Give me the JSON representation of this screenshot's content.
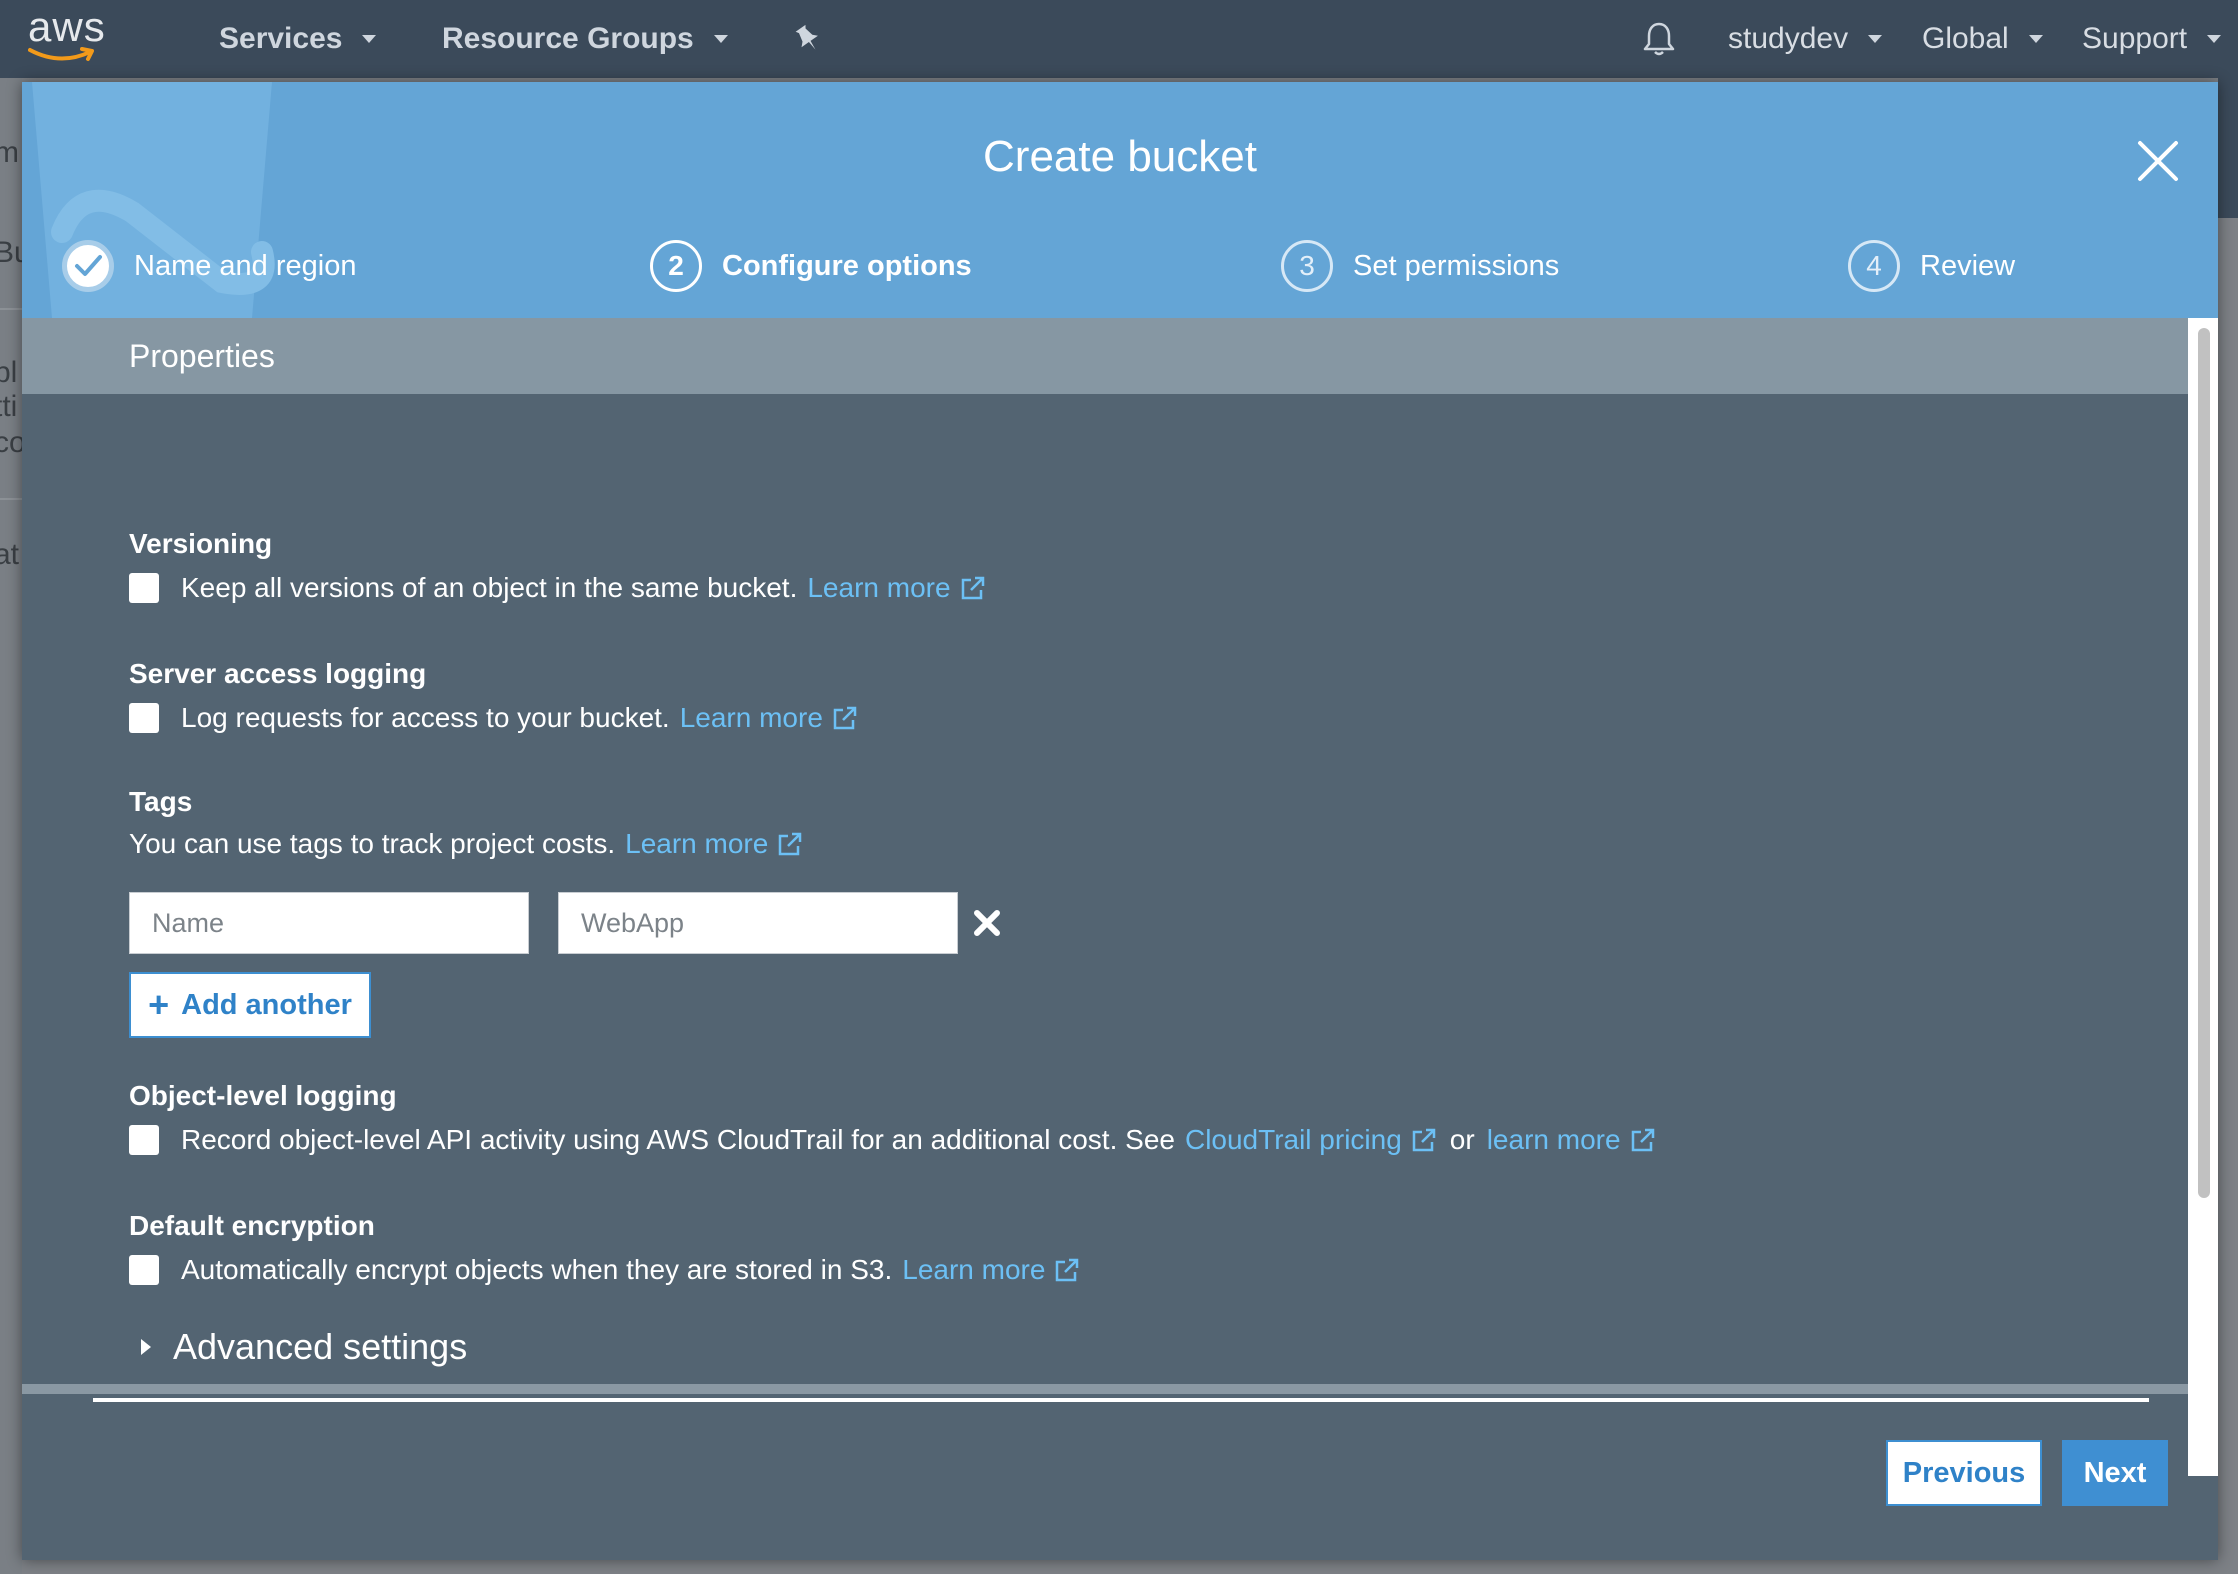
{
  "topnav": {
    "logo_text": "aws",
    "services": "Services",
    "resource_groups": "Resource Groups",
    "pin_icon": "pushpin-icon",
    "bell_icon": "bell-icon",
    "account": "studydev",
    "region": "Global",
    "support": "Support"
  },
  "background_page": {
    "fragments": [
      "m",
      "Bu",
      "bl",
      "tti",
      "co",
      "at"
    ]
  },
  "modal": {
    "title": "Create bucket",
    "close_icon": "close-icon",
    "steps": [
      {
        "number": "1",
        "label": "Name and region",
        "state": "done"
      },
      {
        "number": "2",
        "label": "Configure options",
        "state": "active"
      },
      {
        "number": "3",
        "label": "Set permissions",
        "state": "todo"
      },
      {
        "number": "4",
        "label": "Review",
        "state": "todo"
      }
    ],
    "properties_header": "Properties",
    "versioning": {
      "title": "Versioning",
      "text": "Keep all versions of an object in the same bucket.",
      "link": "Learn more",
      "checked": false
    },
    "server_access_logging": {
      "title": "Server access logging",
      "text": "Log requests for access to your bucket.",
      "link": "Learn more",
      "checked": false
    },
    "tags": {
      "title": "Tags",
      "text": "You can use tags to track project costs.",
      "link": "Learn more",
      "key_placeholder": "Name",
      "value_placeholder": "WebApp",
      "add_label": "Add another"
    },
    "object_level_logging": {
      "title": "Object-level logging",
      "text": "Record object-level API activity using AWS CloudTrail for an additional cost. See",
      "link1": "CloudTrail pricing",
      "or": "or",
      "link2": "learn more",
      "checked": false
    },
    "default_encryption": {
      "title": "Default encryption",
      "text": "Automatically encrypt objects when they are stored in S3.",
      "link": "Learn more",
      "checked": false
    },
    "advanced_settings": "Advanced settings",
    "previous": "Previous",
    "next": "Next"
  },
  "colors": {
    "nav": "#3b4a5a",
    "header": "#64a5d6",
    "body": "#536472",
    "link": "#6cc0f5",
    "primary": "#3f8fd2"
  }
}
